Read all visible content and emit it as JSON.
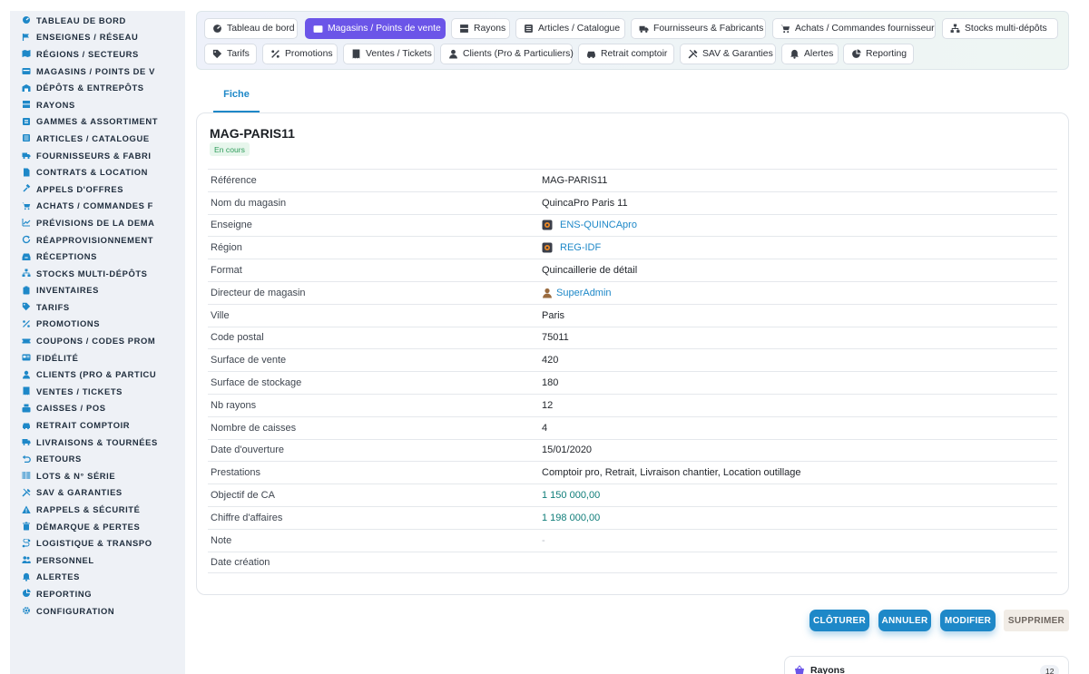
{
  "sidebar": {
    "items": [
      {
        "label": "TABLEAU DE BORD",
        "icon": "dashboard-icon"
      },
      {
        "label": "ENSEIGNES / RÉSEAU",
        "icon": "flag-icon"
      },
      {
        "label": "RÉGIONS / SECTEURS",
        "icon": "map-icon"
      },
      {
        "label": "MAGASINS / POINTS DE V",
        "icon": "store-icon"
      },
      {
        "label": "DÉPÔTS & ENTREPÔTS",
        "icon": "warehouse-icon"
      },
      {
        "label": "RAYONS",
        "icon": "shelf-icon"
      },
      {
        "label": "GAMMES & ASSORTIMENT",
        "icon": "list-icon"
      },
      {
        "label": "ARTICLES / CATALOGUE",
        "icon": "catalog-icon"
      },
      {
        "label": "FOURNISSEURS & FABRI",
        "icon": "truck-icon"
      },
      {
        "label": "CONTRATS & LOCATION",
        "icon": "document-icon"
      },
      {
        "label": "APPELS D'OFFRES",
        "icon": "gavel-icon"
      },
      {
        "label": "ACHATS / COMMANDES F",
        "icon": "cart-icon"
      },
      {
        "label": "PRÉVISIONS DE LA DEMA",
        "icon": "chart-icon"
      },
      {
        "label": "RÉAPPROVISIONNEMENT",
        "icon": "refresh-icon"
      },
      {
        "label": "RÉCEPTIONS",
        "icon": "inbox-icon"
      },
      {
        "label": "STOCKS MULTI-DÉPÔTS",
        "icon": "sitemap-icon"
      },
      {
        "label": "INVENTAIRES",
        "icon": "clipboard-icon"
      },
      {
        "label": "TARIFS",
        "icon": "tag-icon"
      },
      {
        "label": "PROMOTIONS",
        "icon": "percent-icon"
      },
      {
        "label": "COUPONS / CODES PROM",
        "icon": "ticket-icon"
      },
      {
        "label": "FIDÉLITÉ",
        "icon": "card-icon"
      },
      {
        "label": "CLIENTS (PRO & PARTICU",
        "icon": "user-icon"
      },
      {
        "label": "VENTES / TICKETS",
        "icon": "receipt-icon"
      },
      {
        "label": "CAISSES / POS",
        "icon": "register-icon"
      },
      {
        "label": "RETRAIT COMPTOIR",
        "icon": "car-icon"
      },
      {
        "label": "LIVRAISONS & TOURNÉES",
        "icon": "delivery-icon"
      },
      {
        "label": "RETOURS",
        "icon": "undo-icon"
      },
      {
        "label": "LOTS & N° SÉRIE",
        "icon": "barcode-icon"
      },
      {
        "label": "SAV & GARANTIES",
        "icon": "tools-icon"
      },
      {
        "label": "RAPPELS & SÉCURITÉ",
        "icon": "warning-icon"
      },
      {
        "label": "DÉMARQUE & PERTES",
        "icon": "trash-icon"
      },
      {
        "label": "LOGISTIQUE & TRANSPO",
        "icon": "route-icon"
      },
      {
        "label": "PERSONNEL",
        "icon": "users-icon"
      },
      {
        "label": "ALERTES",
        "icon": "bell-icon"
      },
      {
        "label": "REPORTING",
        "icon": "pie-icon"
      },
      {
        "label": "CONFIGURATION",
        "icon": "gear-icon"
      }
    ]
  },
  "tabs": [
    {
      "label": "Tableau de bord",
      "icon": "dashboard-icon",
      "active": false
    },
    {
      "label": "Magasins / Points de vente",
      "icon": "store-icon",
      "active": true
    },
    {
      "label": "Rayons",
      "icon": "shelf-icon",
      "active": false
    },
    {
      "label": "Articles / Catalogue",
      "icon": "catalog-icon",
      "active": false
    },
    {
      "label": "Fournisseurs & Fabricants",
      "icon": "truck-icon",
      "active": false
    },
    {
      "label": "Achats / Commandes fournisseur",
      "icon": "cart-icon",
      "active": false
    },
    {
      "label": "Stocks multi-dépôts",
      "icon": "sitemap-icon",
      "active": false
    },
    {
      "label": "Tarifs",
      "icon": "tag-icon",
      "active": false
    },
    {
      "label": "Promotions",
      "icon": "percent-icon",
      "active": false
    },
    {
      "label": "Ventes / Tickets",
      "icon": "receipt-icon",
      "active": false
    },
    {
      "label": "Clients (Pro & Particuliers)",
      "icon": "user-icon",
      "active": false
    },
    {
      "label": "Retrait comptoir",
      "icon": "car-icon",
      "active": false
    },
    {
      "label": "SAV & Garanties",
      "icon": "tools-icon",
      "active": false
    },
    {
      "label": "Alertes",
      "icon": "bell-icon",
      "active": false
    },
    {
      "label": "Reporting",
      "icon": "pie-icon",
      "active": false
    }
  ],
  "subtab": {
    "label": "Fiche"
  },
  "record": {
    "title": "MAG-PARIS11",
    "status": "En cours",
    "fields": [
      {
        "label": "Référence",
        "value": "MAG-PARIS11",
        "kind": "text"
      },
      {
        "label": "Nom du magasin",
        "value": "QuincaPro Paris 11",
        "kind": "text"
      },
      {
        "label": "Enseigne",
        "value": "ENS-QUINCApro",
        "kind": "link",
        "icon": "record-icon"
      },
      {
        "label": "Région",
        "value": "REG-IDF",
        "kind": "link",
        "icon": "record-icon"
      },
      {
        "label": "Format",
        "value": "Quincaillerie de détail",
        "kind": "text"
      },
      {
        "label": "Directeur de magasin",
        "value": "SuperAdmin",
        "kind": "link",
        "icon": "person-icon"
      },
      {
        "label": "Ville",
        "value": "Paris",
        "kind": "text"
      },
      {
        "label": "Code postal",
        "value": "75011",
        "kind": "text"
      },
      {
        "label": "Surface de vente",
        "value": "420",
        "kind": "text"
      },
      {
        "label": "Surface de stockage",
        "value": "180",
        "kind": "text"
      },
      {
        "label": "Nb rayons",
        "value": "12",
        "kind": "text"
      },
      {
        "label": "Nombre de caisses",
        "value": "4",
        "kind": "text"
      },
      {
        "label": "Date d'ouverture",
        "value": "15/01/2020",
        "kind": "text"
      },
      {
        "label": "Prestations",
        "value": "Comptoir pro, Retrait, Livraison chantier, Location outillage",
        "kind": "text"
      },
      {
        "label": "Objectif de CA",
        "value": "1 150 000,00",
        "kind": "money"
      },
      {
        "label": "Chiffre d'affaires",
        "value": "1 198 000,00",
        "kind": "money"
      },
      {
        "label": "Note",
        "value": "-",
        "kind": "muted"
      },
      {
        "label": "Date création",
        "value": "",
        "kind": "text"
      }
    ]
  },
  "actions": {
    "close_label": "CLÔTURER",
    "cancel_label": "ANNULER",
    "edit_label": "MODIFIER",
    "delete_label": "SUPPRIMER"
  },
  "related": {
    "title": "Rayons",
    "count": "12",
    "icon": "basket-icon"
  },
  "colors": {
    "accent": "#1e88c8",
    "active_tab": "#6b55e8",
    "status_green": "#2e9c5a",
    "money": "#0f7d79",
    "sidebar_icon": "#1e88c8"
  }
}
